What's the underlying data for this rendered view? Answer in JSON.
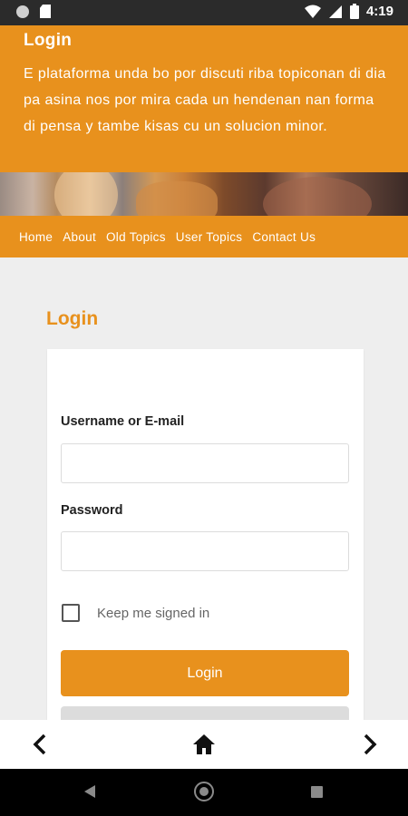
{
  "status_bar": {
    "time": "4:19",
    "icons": [
      "circle-icon",
      "sd-card-icon",
      "wifi-icon",
      "signal-icon",
      "battery-icon"
    ]
  },
  "header": {
    "title": "Login",
    "description": "E plataforma unda bo por discuti riba topiconan di dia pa asina nos por mira cada un hendenan nan forma di pensa y tambe kisas cu un solucion minor."
  },
  "nav": {
    "items": [
      "Home",
      "About",
      "Old Topics",
      "User Topics",
      "Contact Us"
    ]
  },
  "main": {
    "title": "Login",
    "form": {
      "username_label": "Username or E-mail",
      "username_value": "",
      "password_label": "Password",
      "password_value": "",
      "remember_label": "Keep me signed in",
      "remember_checked": false,
      "login_button": "Login"
    }
  },
  "browser_bar": {
    "icons": [
      "chevron-left-icon",
      "home-icon",
      "chevron-right-icon"
    ]
  },
  "android_nav": {
    "icons": [
      "back-triangle-icon",
      "home-circle-icon",
      "recents-square-icon"
    ]
  },
  "colors": {
    "accent": "#e8911d",
    "background": "#eeeeee",
    "status_bar": "#2b2b2b"
  }
}
